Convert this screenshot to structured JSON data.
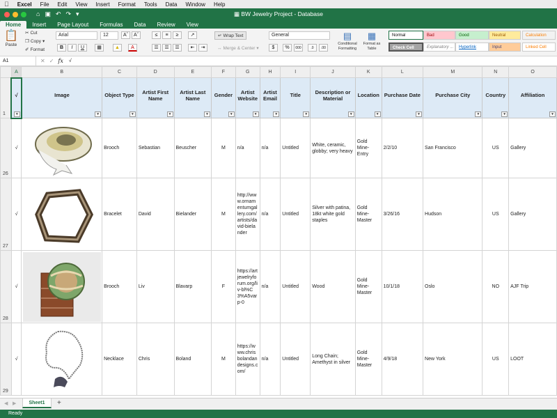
{
  "menubar": {
    "apple": "",
    "app": "Excel",
    "items": [
      "File",
      "Edit",
      "View",
      "Insert",
      "Format",
      "Tools",
      "Data",
      "Window",
      "Help"
    ]
  },
  "window": {
    "title": "BW Jewelry Project - Database"
  },
  "ribbon_tabs": [
    "Home",
    "Insert",
    "Page Layout",
    "Formulas",
    "Data",
    "Review",
    "View"
  ],
  "ribbon": {
    "paste": "Paste",
    "cut": "Cut",
    "copy": "Copy",
    "format": "Format",
    "font": "Arial",
    "size": "12",
    "bold": "B",
    "italic": "I",
    "underline": "U",
    "wrap_text": "Wrap Text",
    "merge": "Merge & Center",
    "number_format": "General",
    "conditional": "Conditional Formatting",
    "format_table": "Format as Table",
    "styles": [
      {
        "label": "Normal",
        "bg": "#ffffff",
        "fg": "#000000"
      },
      {
        "label": "Bad",
        "bg": "#ffc7ce",
        "fg": "#9c0006"
      },
      {
        "label": "Good",
        "bg": "#c6efce",
        "fg": "#006100"
      },
      {
        "label": "Neutral",
        "bg": "#ffeb9c",
        "fg": "#9c5700"
      },
      {
        "label": "Calculation",
        "bg": "#f2f2f2",
        "fg": "#fa7d00"
      },
      {
        "label": "Check Cell",
        "bg": "#a5a5a5",
        "fg": "#ffffff"
      },
      {
        "label": "Explanatory ...",
        "bg": "#ffffff",
        "fg": "#7f7f7f"
      },
      {
        "label": "Hyperlink",
        "bg": "#ffffff",
        "fg": "#0563c1"
      },
      {
        "label": "Input",
        "bg": "#ffcc99",
        "fg": "#3f3f76"
      },
      {
        "label": "Linked Cell",
        "bg": "#ffffff",
        "fg": "#fa7d00"
      }
    ]
  },
  "formula_bar": {
    "cell_ref": "A1",
    "fx": "fx",
    "value": "√"
  },
  "columns": [
    "",
    "A",
    "B",
    "C",
    "D",
    "E",
    "F",
    "G",
    "H",
    "I",
    "J",
    "K",
    "L",
    "M",
    "N",
    "O"
  ],
  "header_row": {
    "row_num": "1",
    "cells": [
      "√",
      "Image",
      "Object Type",
      "Artist First Name",
      "Artist Last Name",
      "Gender",
      "Artist Website",
      "Artist Email",
      "Title",
      "Description or Material",
      "Location",
      "Purchase Date",
      "Purchase City",
      "Country",
      "Affiliation"
    ]
  },
  "rows": [
    {
      "row_num": "26",
      "check": "√",
      "image": "brooch-image",
      "object_type": "Brooch",
      "first": "Sebastian",
      "last": "Beuscher",
      "gender": "M",
      "website": "n/a",
      "email": "n/a",
      "title": "Untitled",
      "description": "White, ceramic, globby; very heavy",
      "location": "Gold Mine-Entry",
      "date": "2/2/10",
      "city": "San Francisco",
      "country": "US",
      "affiliation": "Gallery"
    },
    {
      "row_num": "27",
      "check": "√",
      "image": "bracelet-image",
      "object_type": "Bracelet",
      "first": "David",
      "last": "Bielander",
      "gender": "M",
      "website": "http://www.ornamentumgallery.com/artists/david-bielander",
      "email": "n/a",
      "title": "Untitled",
      "description": "Silver with patina, 18kt white gold staples",
      "location": "Gold Mine-Master",
      "date": "3/26/16",
      "city": "Hudson",
      "country": "US",
      "affiliation": "Gallery"
    },
    {
      "row_num": "28",
      "check": "√",
      "image": "brooch-image",
      "object_type": "Brooch",
      "first": "Liv",
      "last": "Blavarp",
      "gender": "F",
      "website": "https://artjewelryforum.org/liv-bl%C3%A5varp-0",
      "email": "n/a",
      "title": "Untitled",
      "description": "Wood",
      "location": "Gold Mine-Master",
      "date": "10/1/18",
      "city": "Oslo",
      "country": "NO",
      "affiliation": "AJF Trip"
    },
    {
      "row_num": "29",
      "check": "√",
      "image": "necklace-image",
      "object_type": "Necklace",
      "first": "Chris",
      "last": "Boland",
      "gender": "M",
      "website": "https://www.chrisbolandandesigns.com/",
      "email": "n/a",
      "title": "Untitled",
      "description": "Long Chain; Amethyst in silver",
      "location": "Gold Mine-Master",
      "date": "4/9/18",
      "city": "New York",
      "country": "US",
      "affiliation": "LOOT"
    }
  ],
  "sheet_tab": "Sheet1",
  "add_sheet": "+",
  "status": "Ready"
}
